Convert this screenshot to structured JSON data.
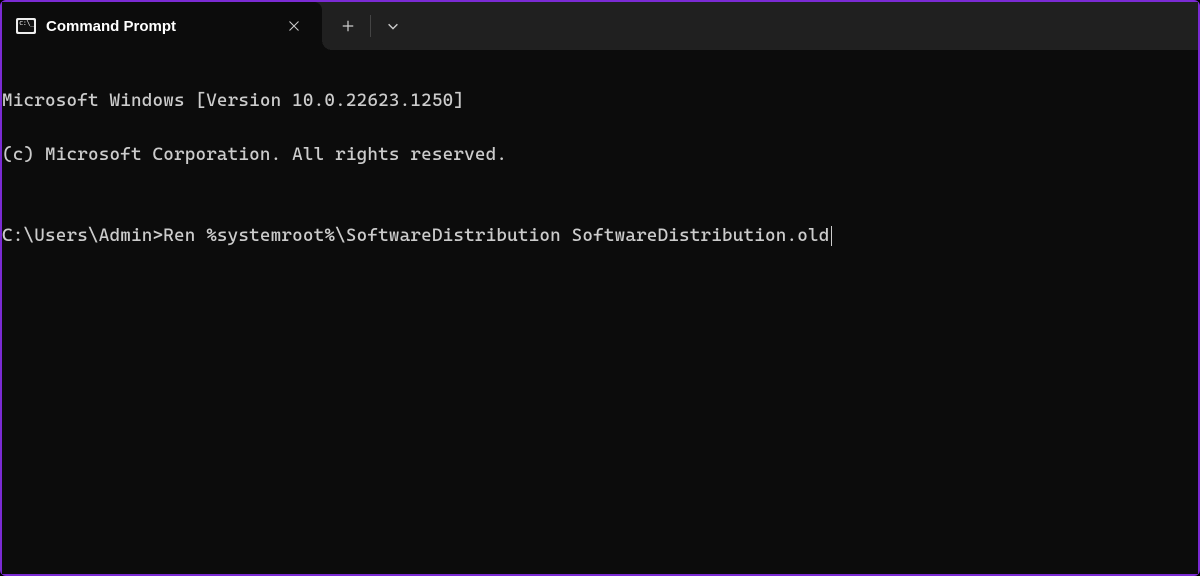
{
  "tab": {
    "title": "Command Prompt"
  },
  "terminal": {
    "line1": "Microsoft Windows [Version 10.0.22623.1250]",
    "line2": "(c) Microsoft Corporation. All rights reserved.",
    "blank": "",
    "prompt": "C:\\Users\\Admin>",
    "command": "Ren %systemroot%\\SoftwareDistribution SoftwareDistribution.old"
  }
}
